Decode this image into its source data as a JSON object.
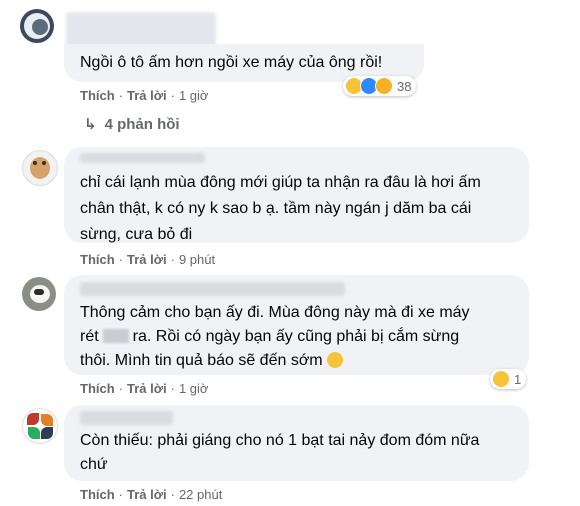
{
  "comments": [
    {
      "text": "Ngồi ô tô ấm hơn ngồi xe máy của ông rồi!",
      "like": "Thích",
      "reply": "Trả lời",
      "time": "1 giờ",
      "reaction_count": "38",
      "reaction_icons": [
        "haha-icon",
        "laugh-icon",
        "sad-icon"
      ]
    },
    {
      "text_lines": [
        "chỉ cái lạnh mùa đông mới giúp ta nhận ra đâu là hơi ấm",
        "chân thật, k có ny k sao b ạ. tầm này ngán j dăm ba cái",
        "sừng, cưa bỏ đi"
      ],
      "like": "Thích",
      "reply": "Trả lời",
      "time": "9 phút"
    },
    {
      "line1": "Thông cảm cho bạn ấy đi. Mùa đông này mà đi xe máy",
      "line2a": "rét",
      "line2b": "ra. Rồi có ngày bạn ấy cũng phải bị cắm sừng",
      "line3": "thôi. Mình tin quả báo sẽ đến sớm",
      "like": "Thích",
      "reply": "Trả lời",
      "time": "1 giờ",
      "reaction_count": "1"
    },
    {
      "text_lines": [
        "Còn thiếu: phải giáng cho nó 1 bạt tai nảy đom đóm nữa",
        "chứ"
      ],
      "like": "Thích",
      "reply": "Trả lời",
      "time": "22 phút"
    }
  ],
  "replies_toggle": "4 phản hồi",
  "colors": {
    "bubble": "#f0f2f5",
    "meta": "#65676b",
    "text": "#050505"
  }
}
